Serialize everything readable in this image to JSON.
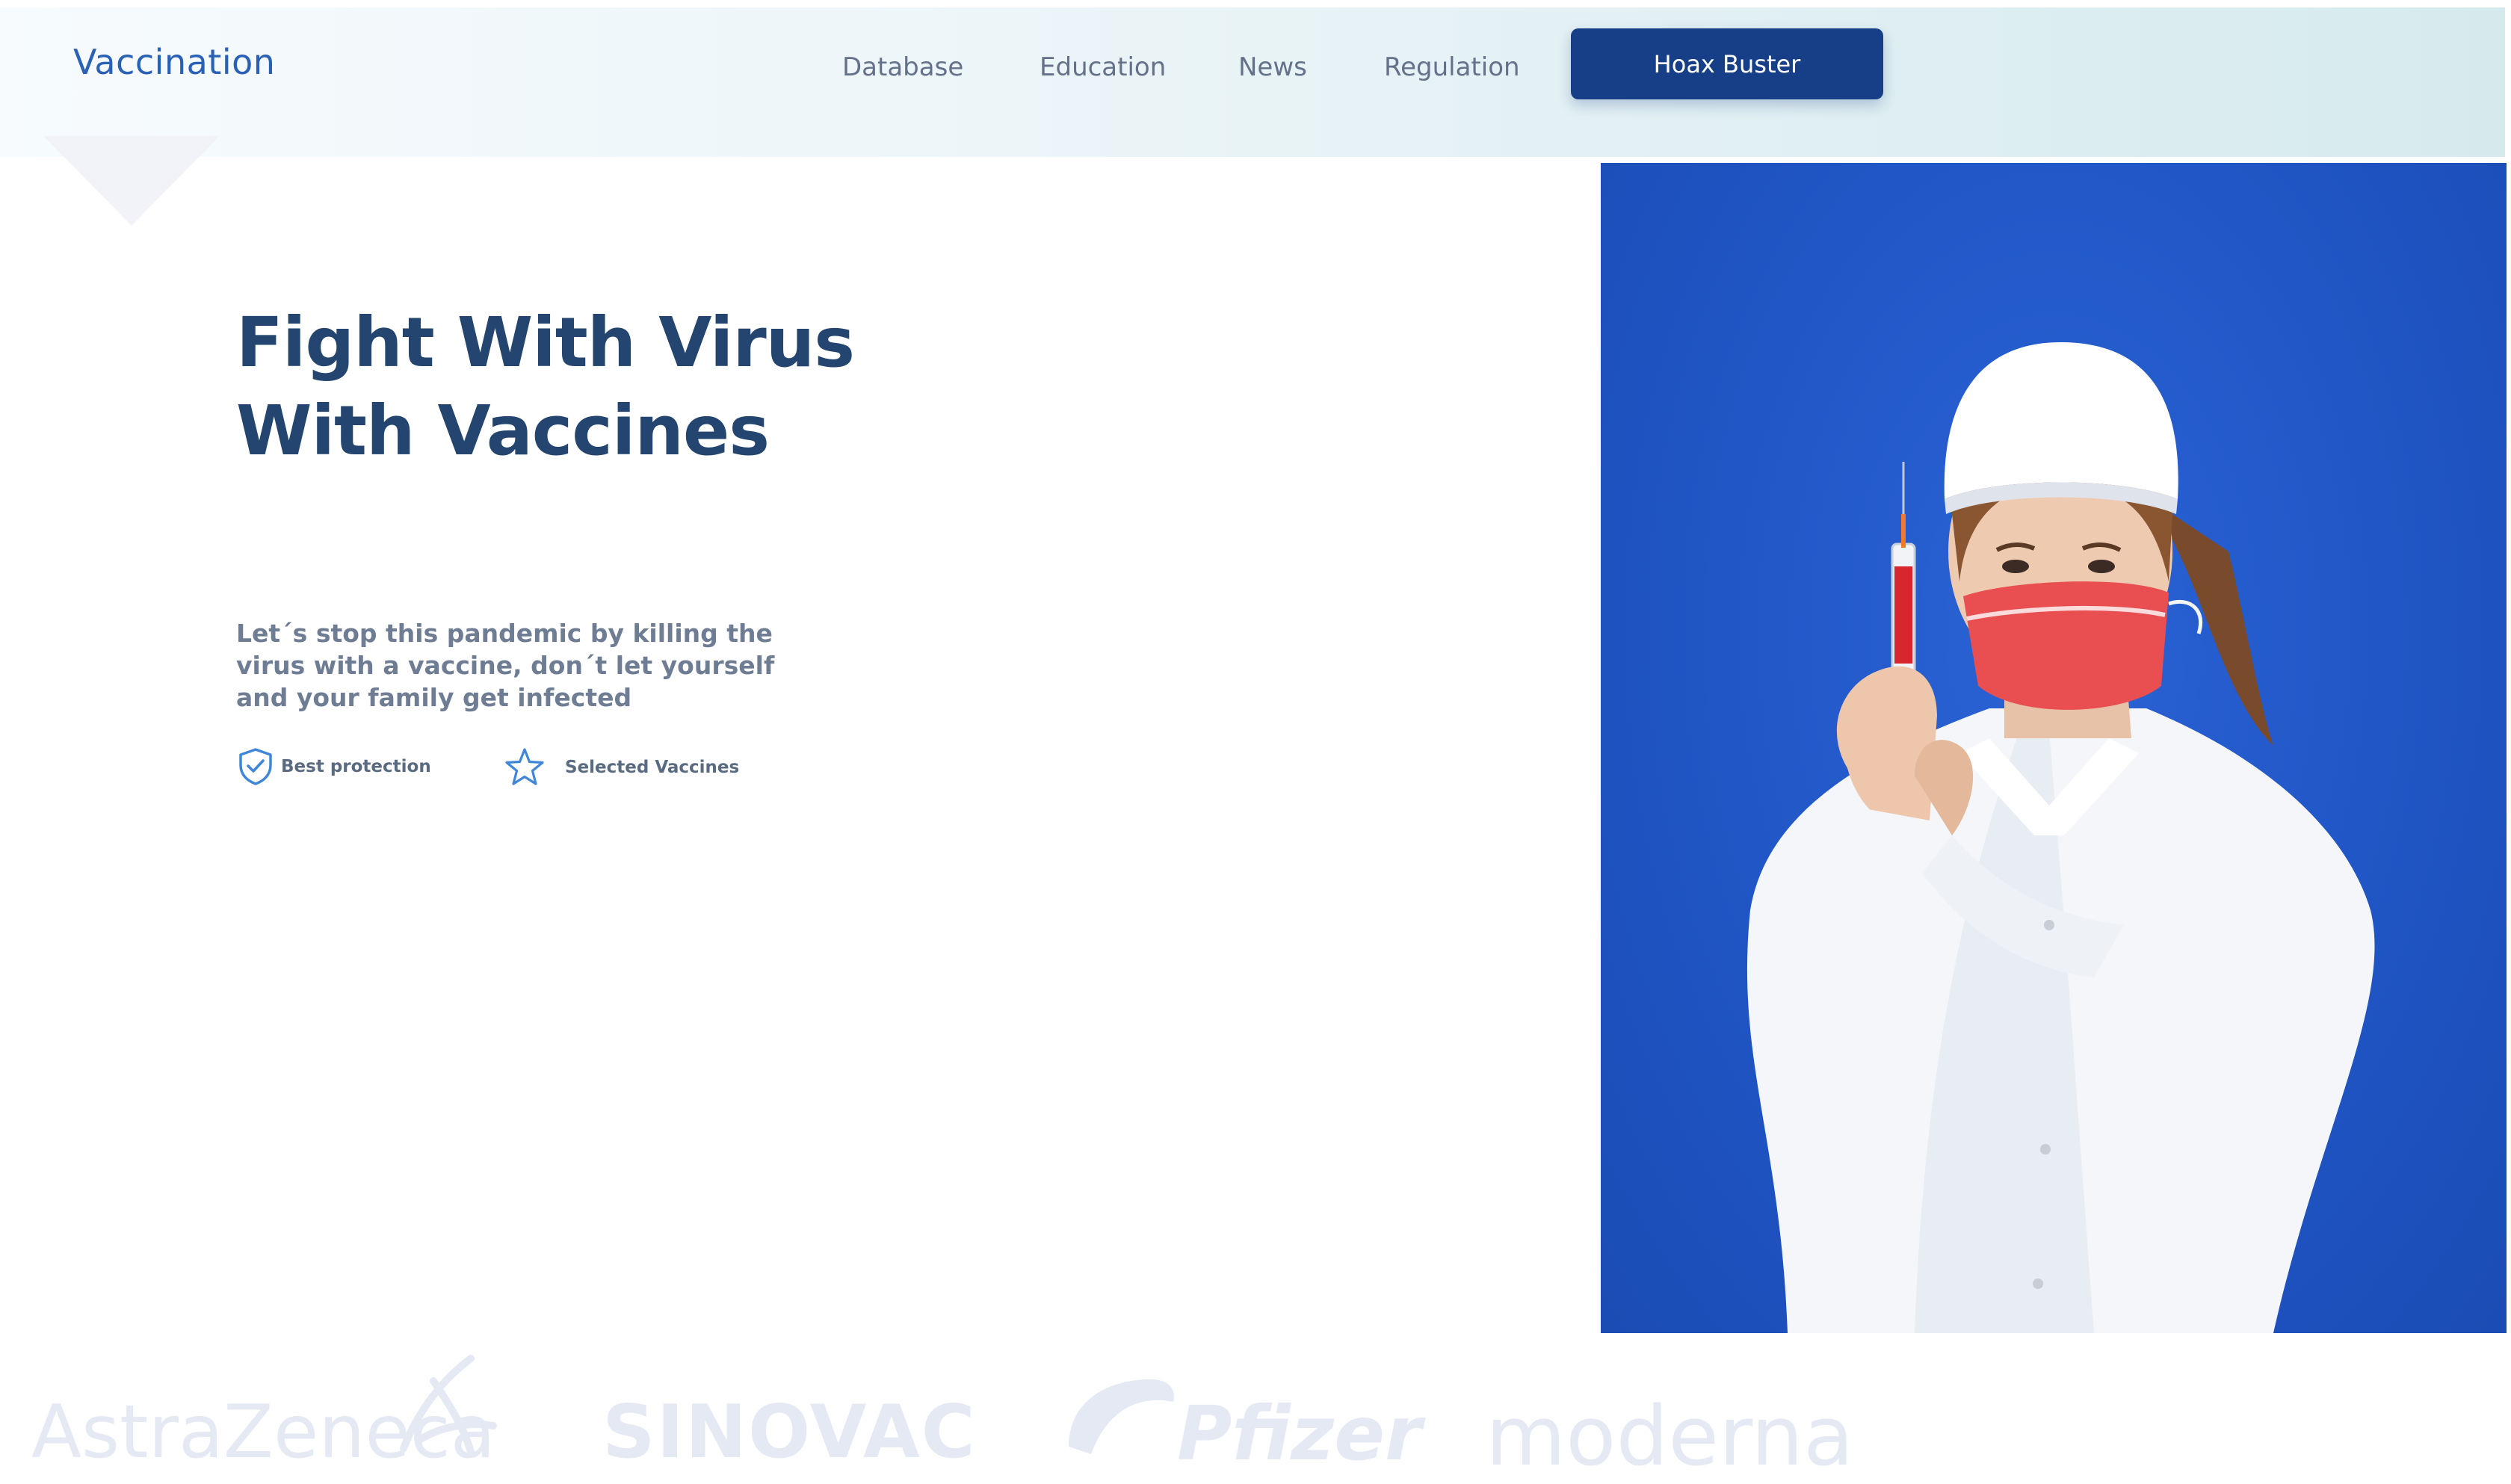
{
  "header": {
    "logo": "Vaccination",
    "nav": [
      "Database",
      "Education",
      "News",
      "Regulation"
    ],
    "cta": "Hoax Buster"
  },
  "hero": {
    "title_line1": "Fight With Virus",
    "title_line2": "With Vaccines",
    "description": "Let´s stop this pandemic by killing the virus with a vaccine, don´t let yourself and your family get infected",
    "features": [
      {
        "label": "Best protection",
        "icon": "shield-check-icon"
      },
      {
        "label": "Selected Vaccines",
        "icon": "star-icon"
      }
    ],
    "image": "nurse-holding-syringe-photo"
  },
  "partners": [
    "AstraZeneca",
    "SINOVAC",
    "Pfizer",
    "moderna"
  ],
  "colors": {
    "brand": "#2a61b7",
    "cta_bg": "#163f88",
    "title": "#23456f",
    "image_bg": "#1f54c3",
    "partner_logo": "#e4e9f4"
  }
}
